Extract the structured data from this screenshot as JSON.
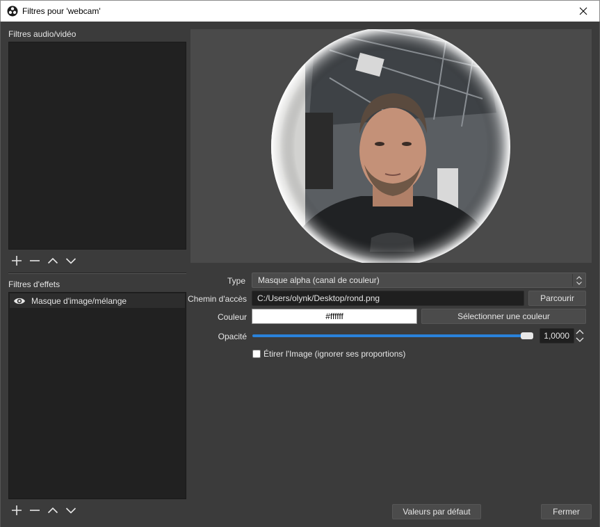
{
  "window": {
    "title": "Filtres pour 'webcam'"
  },
  "icons": {
    "app": "obs-logo-icon",
    "close": "close-icon",
    "add": "plus-icon",
    "remove": "minus-icon",
    "up": "chevron-up-icon",
    "down": "chevron-down-icon",
    "visibility": "eye-icon"
  },
  "av_filters": {
    "label": "Filtres audio/vidéo",
    "items": []
  },
  "effect_filters": {
    "label": "Filtres d'effets",
    "items": [
      {
        "label": "Masque d'image/mélange",
        "visible": true
      }
    ]
  },
  "properties": {
    "type_label": "Type",
    "type_value": "Masque alpha (canal de couleur)",
    "path_label": "Chemin d'accès",
    "path_value": "C:/Users/olynk/Desktop/rond.png",
    "browse_label": "Parcourir",
    "color_label": "Couleur",
    "color_value": "#ffffff",
    "select_color_label": "Sélectionner une couleur",
    "opacity_label": "Opacité",
    "opacity_value": "1,0000",
    "opacity_fraction": 1.0,
    "stretch_label": "Étirer l'Image (ignorer ses proportions)",
    "stretch_checked": false
  },
  "footer": {
    "defaults_label": "Valeurs par défaut",
    "close_label": "Fermer"
  },
  "colors": {
    "accent": "#2a82da",
    "panel": "#3b3b3b",
    "list_bg": "#212121"
  }
}
